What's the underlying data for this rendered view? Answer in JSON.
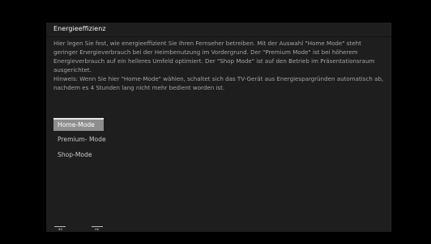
{
  "panel": {
    "title": "Energieeffizienz",
    "description": {
      "paragraph1": "Hier legen Sie fest, wie energieeffizient Sie Ihren Fernseher betreiben. Mit der Auswahl \"Home Mode\" steht geringer Energieverbrauch bei der Heimbenutzung im Vordergrund. Der \"Premium Mode\" ist bei höherem Energieverbrauch auf ein helleres Umfeld optimiert. Der \"Shop Mode\" ist auf den Betrieb im Präsentationsraum ausgerichtet.",
      "paragraph2": "Hinweis: Wenn Sie hier \"Home-Mode\" wählen, schaltet sich das TV-Gerät aus Energiespargründen automatisch ab, nachdem es 4 Stunden lang nicht mehr bedient worden ist."
    },
    "options": [
      {
        "label": "Home-Mode",
        "selected": true
      },
      {
        "label": "Premium- Mode",
        "selected": false
      },
      {
        "label": "Shop-Mode",
        "selected": false
      }
    ],
    "footer": {
      "prev_label": "◂◂",
      "next_label": "▸▸"
    }
  },
  "colors": {
    "panel_background": "#1e1e1e",
    "selected_background": "#8e8e8e",
    "description_text": "#a4a4a4"
  }
}
